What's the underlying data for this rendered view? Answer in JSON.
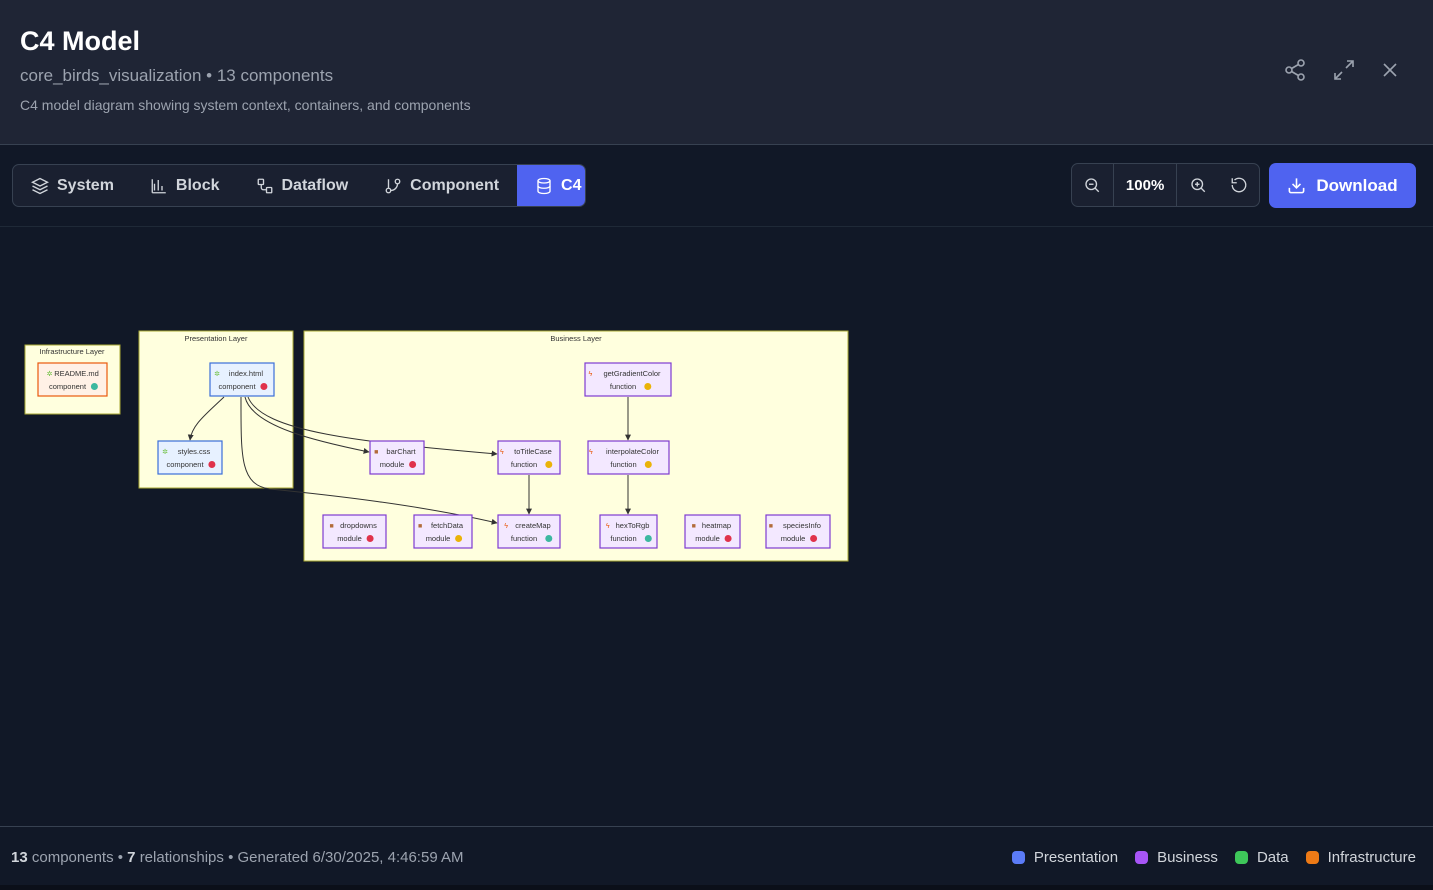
{
  "header": {
    "title": "C4 Model",
    "subtitle": "core_birds_visualization • 13 components",
    "description": "C4 model diagram showing system context, containers, and components"
  },
  "tabs": [
    {
      "label": "System",
      "icon": "layers-icon",
      "active": false
    },
    {
      "label": "Block",
      "icon": "bar-chart-icon",
      "active": false
    },
    {
      "label": "Dataflow",
      "icon": "dataflow-icon",
      "active": false
    },
    {
      "label": "Component",
      "icon": "git-branch-icon",
      "active": false
    },
    {
      "label": "C4",
      "icon": "database-icon",
      "active": true
    }
  ],
  "zoom": {
    "value": "100%"
  },
  "download_label": "Download",
  "diagram": {
    "layers": [
      {
        "label": "Infrastructure Layer"
      },
      {
        "label": "Presentation Layer"
      },
      {
        "label": "Business Layer"
      }
    ],
    "nodes": [
      {
        "id": "readme",
        "name": "README.md",
        "type": "component",
        "status": "teal"
      },
      {
        "id": "index",
        "name": "index.html",
        "type": "component",
        "status": "red"
      },
      {
        "id": "styles",
        "name": "styles.css",
        "type": "component",
        "status": "red"
      },
      {
        "id": "getGradientColor",
        "name": "getGradientColor",
        "type": "function",
        "status": "yellow"
      },
      {
        "id": "barChart",
        "name": "barChart",
        "type": "module",
        "status": "red"
      },
      {
        "id": "toTitleCase",
        "name": "toTitleCase",
        "type": "function",
        "status": "yellow"
      },
      {
        "id": "interpolateColor",
        "name": "interpolateColor",
        "type": "function",
        "status": "yellow"
      },
      {
        "id": "dropdowns",
        "name": "dropdowns",
        "type": "module",
        "status": "red"
      },
      {
        "id": "fetchData",
        "name": "fetchData",
        "type": "module",
        "status": "yellow"
      },
      {
        "id": "createMap",
        "name": "createMap",
        "type": "function",
        "status": "teal"
      },
      {
        "id": "hexToRgb",
        "name": "hexToRgb",
        "type": "function",
        "status": "teal"
      },
      {
        "id": "heatmap",
        "name": "heatmap",
        "type": "module",
        "status": "red"
      },
      {
        "id": "speciesInfo",
        "name": "speciesInfo",
        "type": "module",
        "status": "red"
      }
    ],
    "status_colors": {
      "red": "#e0324b",
      "yellow": "#eab308",
      "teal": "#3cb8a0"
    }
  },
  "footer": {
    "components_count": "13",
    "components_label": "components",
    "relationships_count": "7",
    "relationships_label": "relationships",
    "generated": "Generated 6/30/2025, 4:46:59 AM"
  },
  "legend": [
    {
      "label": "Presentation",
      "color": "#5b7bf7"
    },
    {
      "label": "Business",
      "color": "#a855f7"
    },
    {
      "label": "Data",
      "color": "#3ec75a"
    },
    {
      "label": "Infrastructure",
      "color": "#ee7a16"
    }
  ]
}
